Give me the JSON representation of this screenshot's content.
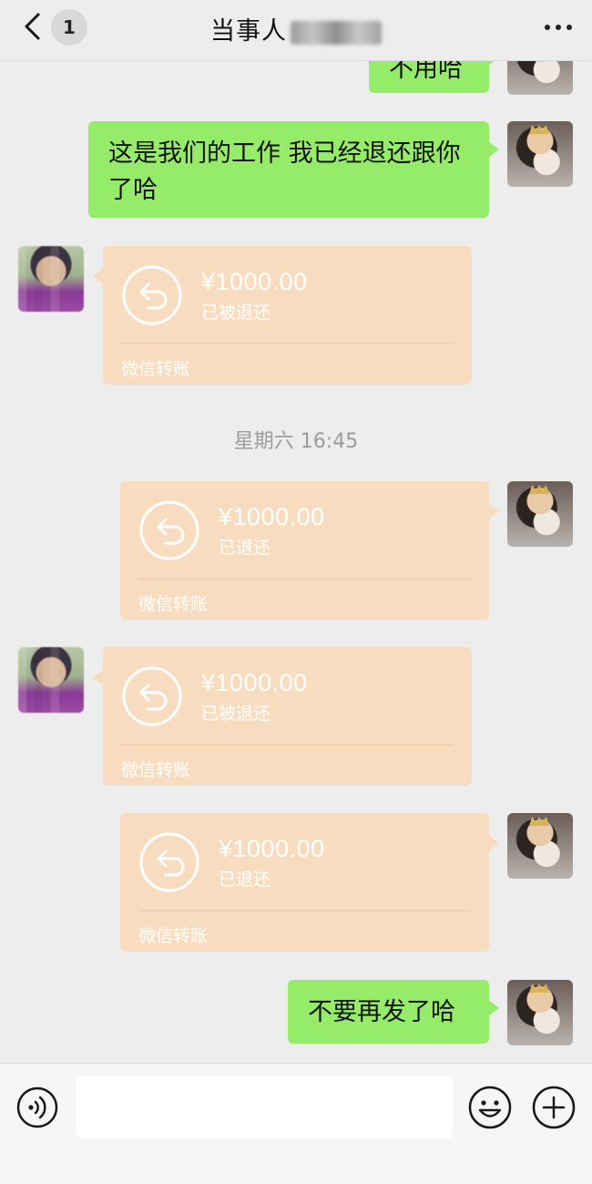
{
  "header": {
    "unread_count": "1",
    "title": "当事人",
    "back_icon": "chevron-left-icon",
    "more_icon": "more-dots-icon"
  },
  "messages": [
    {
      "type": "text",
      "from": "self",
      "text": "不用哈"
    },
    {
      "type": "text",
      "from": "self",
      "text": "这是我们的工作 我已经退还跟你了哈"
    },
    {
      "type": "transfer",
      "from": "other",
      "amount": "¥1000.00",
      "status": "已被退还",
      "label": "微信转账"
    },
    {
      "type": "transfer",
      "from": "self",
      "amount": "¥1000.00",
      "status": "已退还",
      "label": "微信转账"
    },
    {
      "type": "transfer",
      "from": "other",
      "amount": "¥1000.00",
      "status": "已被退还",
      "label": "微信转账"
    },
    {
      "type": "transfer",
      "from": "self",
      "amount": "¥1000.00",
      "status": "已退还",
      "label": "微信转账"
    },
    {
      "type": "text",
      "from": "self",
      "text": "不要再发了哈"
    }
  ],
  "timestamp": "星期六 16:45",
  "input_bar": {
    "voice_icon": "voice-icon",
    "emoji_icon": "emoji-icon",
    "plus_icon": "plus-icon",
    "text_value": ""
  },
  "colors": {
    "background": "#ededed",
    "self_bubble": "#95ec69",
    "transfer_card": "#f8dcbf"
  }
}
